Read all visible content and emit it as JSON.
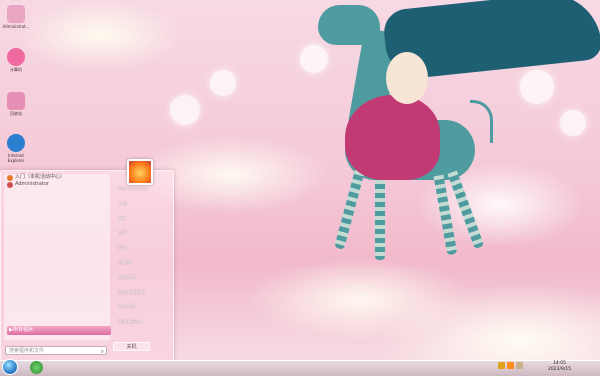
{
  "desktop": {
    "icons": [
      {
        "label": "Administrat...",
        "icon": "user-folder-icon",
        "color": "#e9a6c2"
      },
      {
        "label": "计算机",
        "icon": "computer-icon",
        "color": "#f06aa0"
      },
      {
        "label": "回收站",
        "icon": "recycle-bin-icon",
        "color": "#e68fb5"
      },
      {
        "label": "Internet Explorer",
        "icon": "ie-icon",
        "color": "#2b7fd0"
      }
    ]
  },
  "start_menu": {
    "pinned": [
      {
        "label": "入门（本机活动中心）",
        "icon": "getting-started-icon",
        "color": "#e9772c"
      },
      {
        "label": "Administrator",
        "icon": "user-icon",
        "color": "#d04e4e"
      }
    ],
    "all_programs_label": "所有程序",
    "search_placeholder": "搜索程序和文件",
    "right_items": [
      "Administrator",
      "文档",
      "图片",
      "音乐",
      "游戏",
      "计算机",
      "控制面板",
      "设备和打印机",
      "默认程序",
      "帮助和支持"
    ],
    "shutdown_label": "关机"
  },
  "taskbar": {
    "pinned": [
      {
        "icon": "ie-taskbar-icon",
        "color": "#3aa83a"
      }
    ],
    "tray_icons": [
      "network-icon",
      "volume-icon",
      "flag-icon"
    ],
    "time": "14:05",
    "date": "2023/9/15"
  },
  "colors": {
    "accent": "#dd6ea0",
    "hair": "#1f5f73",
    "horse": "#4e9ca0",
    "dress": "#c13a74"
  }
}
